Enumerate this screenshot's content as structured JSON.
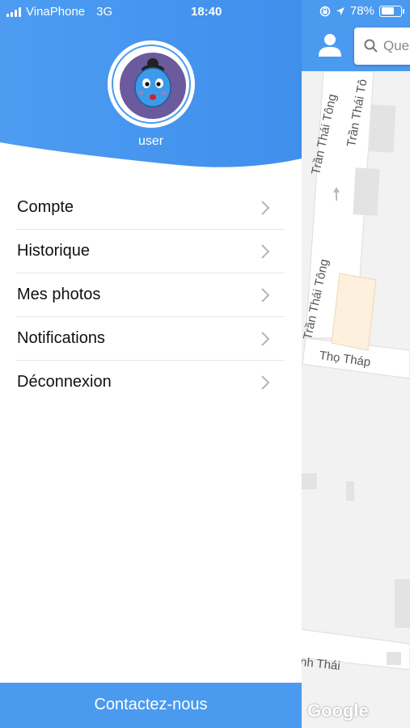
{
  "status_bar": {
    "carrier": "VinaPhone",
    "network": "3G",
    "time": "18:40",
    "battery_percent": "78%",
    "battery_level": 0.78
  },
  "drawer": {
    "username": "user",
    "menu": [
      {
        "label": "Compte"
      },
      {
        "label": "Historique"
      },
      {
        "label": "Mes photos"
      },
      {
        "label": "Notifications"
      },
      {
        "label": "Déconnexion"
      }
    ],
    "contact_label": "Contactez-nous"
  },
  "map": {
    "search_placeholder": "Que",
    "streets": {
      "tran_thai_tong_1": "Trần Thái Tông",
      "tran_thai_tong_2": "Trần Thái Tô",
      "tran_thai_tong_3": "Trần Thái Tông",
      "tho_thap": "Thọ Tháp",
      "thai_bottom": "nh Thái"
    },
    "attribution": "Google"
  },
  "colors": {
    "accent": "#4a9af0",
    "avatar_bg": "#6b5a9e"
  }
}
